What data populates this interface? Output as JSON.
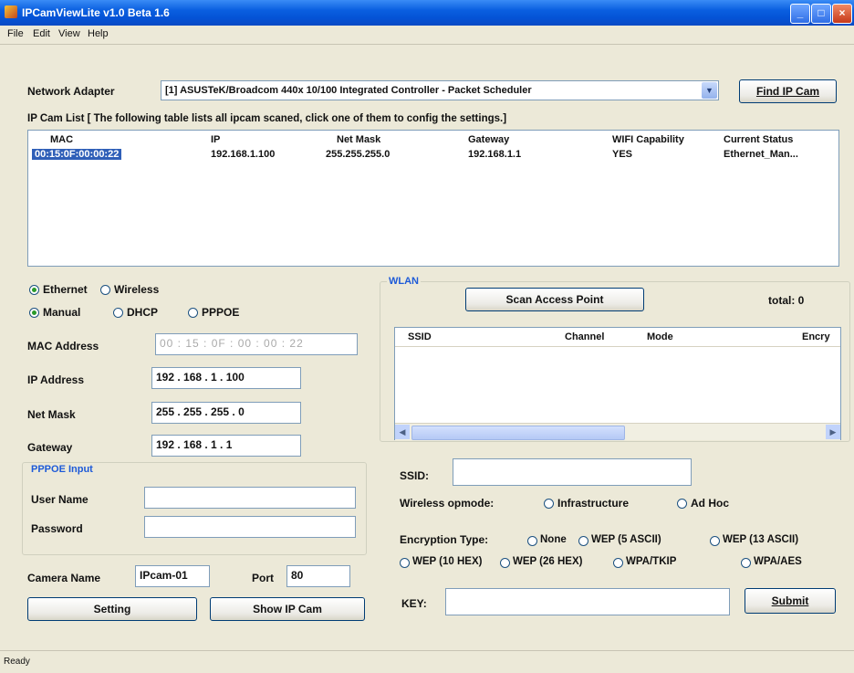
{
  "window": {
    "title": "IPCamViewLite v1.0 Beta 1.6",
    "minimize": "_",
    "maximize": "□",
    "close": "×"
  },
  "menu": [
    "File",
    "Edit",
    "View",
    "Help"
  ],
  "adapter": {
    "label": "Network Adapter",
    "value": "[1] ASUSTeK/Broadcom 440x 10/100 Integrated Controller - Packet Scheduler",
    "find_button": "Find IP Cam"
  },
  "ipcam_list": {
    "caption": "IP Cam List  [ The following table lists all ipcam scaned, click one of them to config the settings.]",
    "columns": [
      "MAC",
      "IP",
      "Net Mask",
      "Gateway",
      "WIFI Capability",
      "Current Status"
    ],
    "rows": [
      [
        "00:15:0F:00:00:22",
        "192.168.1.100",
        "255.255.255.0",
        "192.168.1.1",
        "YES",
        "Ethernet_Man..."
      ]
    ]
  },
  "mode": {
    "ethernet": "Ethernet",
    "wireless": "Wireless",
    "manual": "Manual",
    "dhcp": "DHCP",
    "pppoe": "PPPOE"
  },
  "fields": {
    "mac_label": "MAC Address",
    "mac_value": "00 : 15 : 0F : 00 : 00 : 22",
    "ip_label": "IP Address",
    "ip_value": "192 . 168 .  1 . 100",
    "mask_label": "Net Mask",
    "mask_value": "255 . 255 . 255 . 0",
    "gw_label": "Gateway",
    "gw_value": "192 . 168 . 1 . 1"
  },
  "pppoe": {
    "title": "PPPOE Input",
    "user_label": "User Name",
    "pass_label": "Password",
    "user_value": "",
    "pass_value": ""
  },
  "camera": {
    "name_label": "Camera Name",
    "name_value": "IPcam-01",
    "port_label": "Port",
    "port_value": "80"
  },
  "buttons": {
    "setting": "Setting",
    "show": "Show IP Cam"
  },
  "wlan": {
    "title": "WLAN",
    "scan_button": "Scan Access Point",
    "total": "total:  0",
    "columns": [
      "SSID",
      "Channel",
      "Mode",
      "Encry"
    ],
    "ssid_label": "SSID:",
    "ssid_value": "",
    "opmode_label": "Wireless opmode:",
    "infrastructure": "Infrastructure",
    "adhoc": "Ad Hoc",
    "enc_label": "Encryption Type:",
    "enc": [
      "None",
      "WEP (5 ASCII)",
      "WEP (13 ASCII)",
      "WEP (10 HEX)",
      "WEP (26 HEX)",
      "WPA/TKIP",
      "WPA/AES"
    ],
    "key_label": "KEY:",
    "key_value": "",
    "submit": "Submit"
  },
  "status_bar": "Ready"
}
